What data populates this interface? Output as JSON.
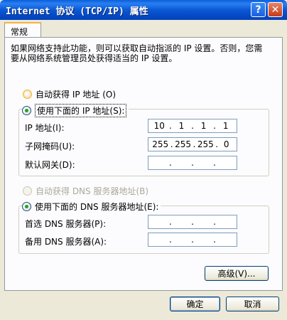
{
  "window": {
    "title": "Internet 协议 (TCP/IP) 属性",
    "help_glyph": "?",
    "close_glyph": "✕"
  },
  "tabs": [
    {
      "label": "常规"
    }
  ],
  "intro": "如果网络支持此功能，则可以获取自动指派的 IP 设置。否则，您需要从网络系统管理员处获得适当的 IP 设置。",
  "ip_section": {
    "auto_label": "自动获得 IP 地址 (O)",
    "manual_label": "使用下面的 IP 地址(S):",
    "selected": "manual",
    "fields": [
      {
        "label": "IP 地址(I):",
        "octets": [
          "10",
          "1",
          "1",
          "1"
        ]
      },
      {
        "label": "子网掩码(U):",
        "octets": [
          "255",
          "255",
          "255",
          "0"
        ]
      },
      {
        "label": "默认网关(D):",
        "octets": [
          "",
          "",
          "",
          ""
        ]
      }
    ]
  },
  "dns_section": {
    "auto_label": "自动获得 DNS 服务器地址(B)",
    "manual_label": "使用下面的 DNS 服务器地址(E):",
    "selected": "manual",
    "fields": [
      {
        "label": "首选 DNS 服务器(P):",
        "octets": [
          "",
          "",
          "",
          ""
        ]
      },
      {
        "label": "备用 DNS 服务器(A):",
        "octets": [
          "",
          "",
          "",
          ""
        ]
      }
    ]
  },
  "buttons": {
    "advanced": "高级(V)...",
    "ok": "确定",
    "cancel": "取消"
  }
}
